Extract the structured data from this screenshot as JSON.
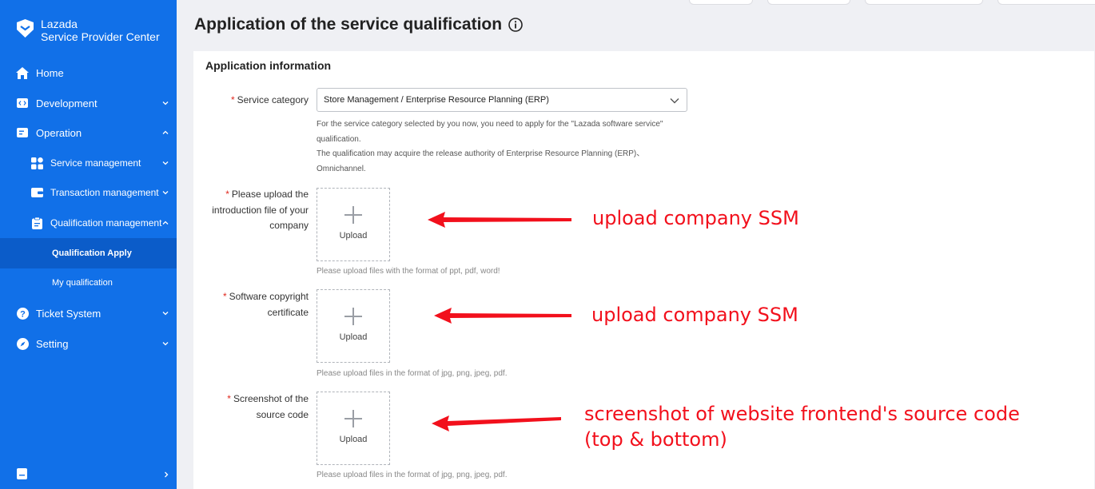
{
  "brand": {
    "line1": "Lazada",
    "line2": "Service Provider Center"
  },
  "sidebar": {
    "items": [
      {
        "label": "Home",
        "icon": "home-icon"
      },
      {
        "label": "Development",
        "icon": "code-icon"
      },
      {
        "label": "Operation",
        "icon": "operation-icon"
      },
      {
        "label": "Service management",
        "icon": "grid-icon"
      },
      {
        "label": "Transaction management",
        "icon": "wallet-icon"
      },
      {
        "label": "Qualification management",
        "icon": "clipboard-icon"
      },
      {
        "label": "Qualification Apply"
      },
      {
        "label": "My qualification"
      },
      {
        "label": "Ticket System",
        "icon": "question-icon"
      },
      {
        "label": "Setting",
        "icon": "compass-icon"
      }
    ],
    "active": "Qualification Apply"
  },
  "page": {
    "title": "Application of the service qualification",
    "section_title": "Application information"
  },
  "form": {
    "required_mark": "*",
    "service_category": {
      "label": "Service category",
      "value": "Store Management / Enterprise Resource Planning (ERP)",
      "hint_lines": [
        "For the service category selected by you now, you need to apply for the \"Lazada software service\"",
        "qualification.",
        "The qualification may acquire the release authority of Enterprise Resource Planning (ERP)、",
        "Omnichannel."
      ]
    },
    "intro_file": {
      "label_lines": [
        "Please upload the",
        "introduction file of your",
        "company"
      ],
      "upload_label": "Upload",
      "hint": "Please upload files with the format of ppt, pdf, word!"
    },
    "copyright": {
      "label_lines": [
        "Software copyright",
        "certificate"
      ],
      "upload_label": "Upload",
      "hint": "Please upload files in the format of jpg, png, jpeg, pdf."
    },
    "screenshot": {
      "label_lines": [
        "Screenshot of the",
        "source code"
      ],
      "upload_label": "Upload",
      "hint": "Please upload files in the format of jpg, png, jpeg, pdf."
    }
  },
  "annotations": {
    "a1": "upload company SSM",
    "a2": "upload company SSM",
    "a3_line1": "screenshot of website frontend's source code",
    "a3_line2": "(top & bottom)",
    "color": "#f2101c"
  },
  "colors": {
    "sidebar": "#1170e8",
    "active": "#0b5cc9",
    "required": "#e0281e"
  }
}
